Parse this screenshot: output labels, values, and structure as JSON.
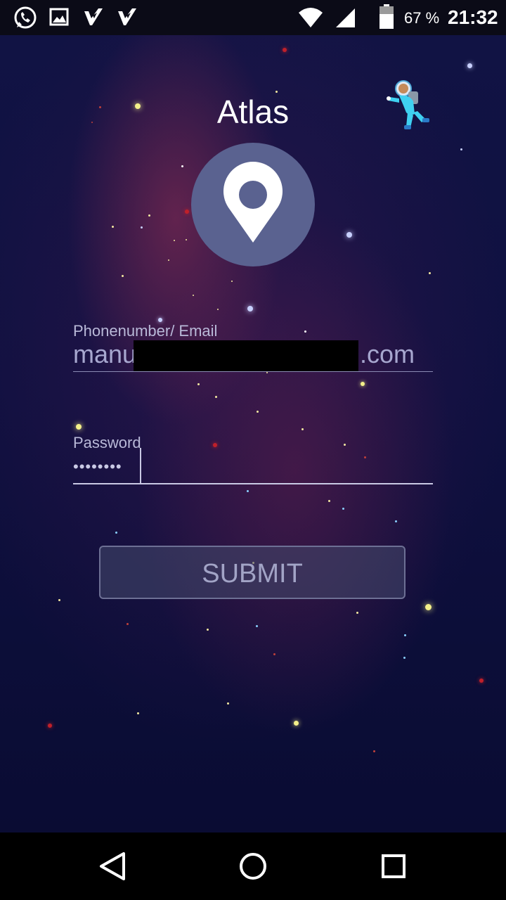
{
  "status_bar": {
    "icons": [
      "whatsapp-icon",
      "gallery-icon",
      "check-app-icon",
      "check-app-icon",
      "wifi-icon",
      "cell-signal-icon",
      "battery-icon"
    ],
    "battery_percent": "67 %",
    "time": "21:32"
  },
  "app": {
    "title": "Atlas",
    "logo_icon": "location-pin-icon",
    "decoration_icon": "astronaut-icon"
  },
  "form": {
    "email_label": "Phonenumber/ Email",
    "email_value_visible_start": "manu",
    "email_value_visible_end": ".com",
    "password_label": "Password",
    "password_value": "••••••••",
    "submit_label": "SUBMIT"
  },
  "colors": {
    "background_dark": "#0b0d35",
    "logo_circle": "#5a6290",
    "text_light": "#ffffff",
    "field_text": "#a7a7cf"
  },
  "nav_bar": {
    "icons": [
      "back-icon",
      "home-icon",
      "recents-icon"
    ]
  }
}
